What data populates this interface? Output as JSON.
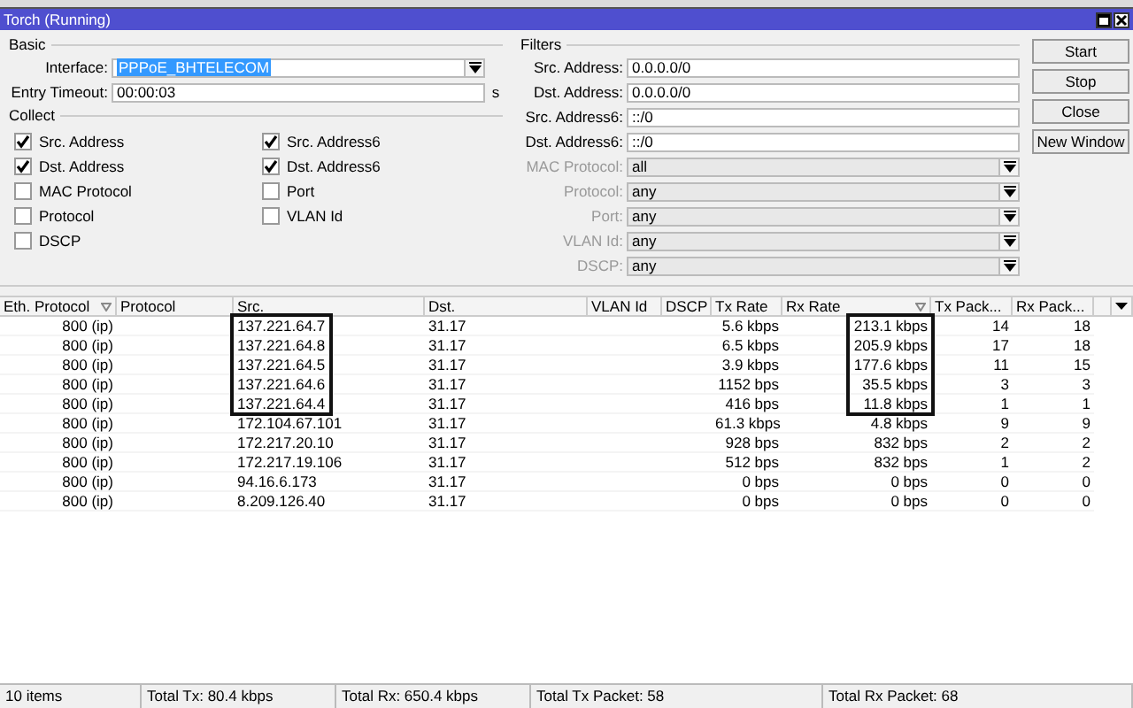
{
  "window": {
    "title": "Torch (Running)"
  },
  "basic": {
    "legend": "Basic",
    "interface": {
      "label": "Interface:",
      "value": "PPPoE_BHTELECOM"
    },
    "entry_timeout": {
      "label": "Entry Timeout:",
      "value": "00:00:03",
      "unit": "s"
    }
  },
  "collect": {
    "legend": "Collect",
    "items": [
      {
        "label": "Src. Address",
        "checked": true
      },
      {
        "label": "Dst. Address",
        "checked": true
      },
      {
        "label": "MAC Protocol",
        "checked": false
      },
      {
        "label": "Protocol",
        "checked": false
      },
      {
        "label": "DSCP",
        "checked": false
      },
      {
        "label": "Src. Address6",
        "checked": true
      },
      {
        "label": "Dst. Address6",
        "checked": true
      },
      {
        "label": "Port",
        "checked": false
      },
      {
        "label": "VLAN Id",
        "checked": false
      }
    ]
  },
  "filters": {
    "legend": "Filters",
    "fields": [
      {
        "kind": "text",
        "label": "Src. Address:",
        "value": "0.0.0.0/0",
        "disabled": false
      },
      {
        "kind": "text",
        "label": "Dst. Address:",
        "value": "0.0.0.0/0",
        "disabled": false
      },
      {
        "kind": "text",
        "label": "Src. Address6:",
        "value": "::/0",
        "disabled": false
      },
      {
        "kind": "text",
        "label": "Dst. Address6:",
        "value": "::/0",
        "disabled": false
      },
      {
        "kind": "select",
        "label": "MAC Protocol:",
        "value": "all",
        "disabled": true
      },
      {
        "kind": "select",
        "label": "Protocol:",
        "value": "any",
        "disabled": true
      },
      {
        "kind": "select",
        "label": "Port:",
        "value": "any",
        "disabled": true
      },
      {
        "kind": "select",
        "label": "VLAN Id:",
        "value": "any",
        "disabled": true
      },
      {
        "kind": "select",
        "label": "DSCP:",
        "value": "any",
        "disabled": true
      }
    ]
  },
  "buttons": [
    "Start",
    "Stop",
    "Close",
    "New Window"
  ],
  "table": {
    "columns": [
      {
        "label": "Eth. Protocol",
        "sorted": true,
        "highlighted": false
      },
      {
        "label": "Protocol",
        "sorted": false,
        "highlighted": false
      },
      {
        "label": "Src.",
        "sorted": false,
        "highlighted": true
      },
      {
        "label": "Dst.",
        "sorted": false,
        "highlighted": false
      },
      {
        "label": "VLAN Id",
        "sorted": false,
        "highlighted": false
      },
      {
        "label": "DSCP",
        "sorted": false,
        "highlighted": false
      },
      {
        "label": "Tx Rate",
        "sorted": false,
        "highlighted": false
      },
      {
        "label": "Rx Rate",
        "sorted": true,
        "highlighted": true
      },
      {
        "label": "Tx Pack...",
        "sorted": false,
        "highlighted": false
      },
      {
        "label": "Rx Pack...",
        "sorted": false,
        "highlighted": false
      }
    ],
    "rows": [
      {
        "highlighted": true,
        "cells": [
          "800 (ip)",
          "",
          "137.221.64.7",
          "31.17",
          "",
          "",
          "5.6 kbps",
          "213.1 kbps",
          "14",
          "18"
        ]
      },
      {
        "highlighted": true,
        "cells": [
          "800 (ip)",
          "",
          "137.221.64.8",
          "31.17",
          "",
          "",
          "6.5 kbps",
          "205.9 kbps",
          "17",
          "18"
        ]
      },
      {
        "highlighted": true,
        "cells": [
          "800 (ip)",
          "",
          "137.221.64.5",
          "31.17",
          "",
          "",
          "3.9 kbps",
          "177.6 kbps",
          "11",
          "15"
        ]
      },
      {
        "highlighted": true,
        "cells": [
          "800 (ip)",
          "",
          "137.221.64.6",
          "31.17",
          "",
          "",
          "1152 bps",
          "35.5 kbps",
          "3",
          "3"
        ]
      },
      {
        "highlighted": true,
        "cells": [
          "800 (ip)",
          "",
          "137.221.64.4",
          "31.17",
          "",
          "",
          "416 bps",
          "11.8 kbps",
          "1",
          "1"
        ]
      },
      {
        "highlighted": false,
        "cells": [
          "800 (ip)",
          "",
          "172.104.67.101",
          "31.17",
          "",
          "",
          "61.3 kbps",
          "4.8 kbps",
          "9",
          "9"
        ]
      },
      {
        "highlighted": false,
        "cells": [
          "800 (ip)",
          "",
          "172.217.20.10",
          "31.17",
          "",
          "",
          "928 bps",
          "832 bps",
          "2",
          "2"
        ]
      },
      {
        "highlighted": false,
        "cells": [
          "800 (ip)",
          "",
          "172.217.19.106",
          "31.17",
          "",
          "",
          "512 bps",
          "832 bps",
          "1",
          "2"
        ]
      },
      {
        "highlighted": false,
        "cells": [
          "800 (ip)",
          "",
          "94.16.6.173",
          "31.17",
          "",
          "",
          "0 bps",
          "0 bps",
          "0",
          "0"
        ]
      },
      {
        "highlighted": false,
        "cells": [
          "800 (ip)",
          "",
          "8.209.126.40",
          "31.17",
          "",
          "",
          "0 bps",
          "0 bps",
          "0",
          "0"
        ]
      }
    ]
  },
  "status_bar": [
    "10 items",
    "Total Tx: 80.4 kbps",
    "Total Rx: 650.4 kbps",
    "Total Tx Packet: 58",
    "Total Rx Packet: 68"
  ]
}
